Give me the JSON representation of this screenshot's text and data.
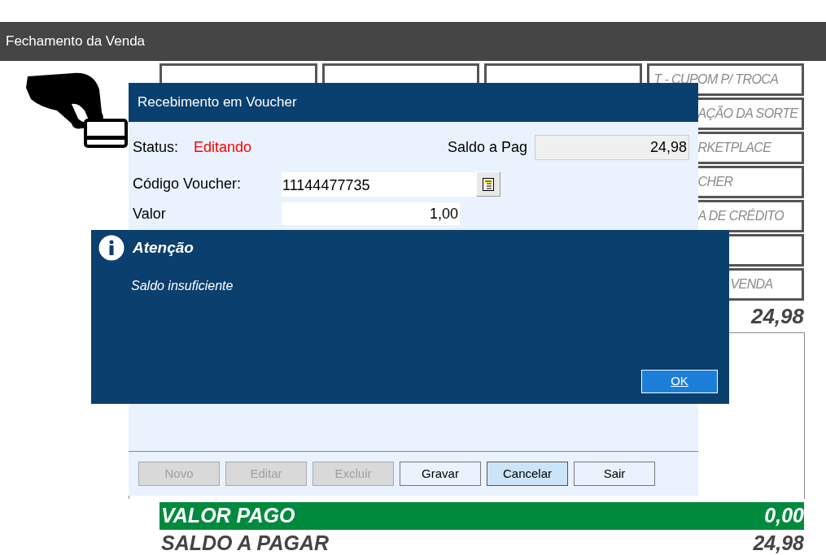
{
  "window": {
    "title": "Fechamento da Venda"
  },
  "payment_buttons": [
    {
      "label": "T - CUPOM P/ TROCA"
    },
    {
      "label": "AÇÃO DA SORTE"
    },
    {
      "label": "RKETPLACE"
    },
    {
      "label": "CHER"
    },
    {
      "label": "A DE CRÉDITO"
    },
    {
      "label": "VENDA"
    }
  ],
  "total": "24,98",
  "voucher_dialog": {
    "title": "Recebimento em Voucher",
    "status_label": "Status:",
    "status_value": "Editando",
    "balance_label": "Saldo a Pag",
    "balance_value": "24,98",
    "code_label": "Código Voucher:",
    "code_value": "11144477735",
    "value_label": "Valor",
    "value_value": "1,00",
    "buttons": [
      {
        "label": "Novo",
        "disabled": true,
        "focused": false
      },
      {
        "label": "Editar",
        "disabled": true,
        "focused": false
      },
      {
        "label": "Excluir",
        "disabled": true,
        "focused": false
      },
      {
        "label": "Gravar",
        "disabled": false,
        "focused": false
      },
      {
        "label": "Cancelar",
        "disabled": false,
        "focused": true
      },
      {
        "label": "Sair",
        "disabled": false,
        "focused": false
      }
    ]
  },
  "alert": {
    "title": "Atenção",
    "message": "Saldo insuficiente",
    "button": "OK"
  },
  "summary": [
    {
      "label": "VALOR PAGO",
      "value": "0,00",
      "kind": "highlight"
    },
    {
      "label": "SALDO A PAGAR",
      "value": "24,98",
      "kind": "plain"
    }
  ]
}
